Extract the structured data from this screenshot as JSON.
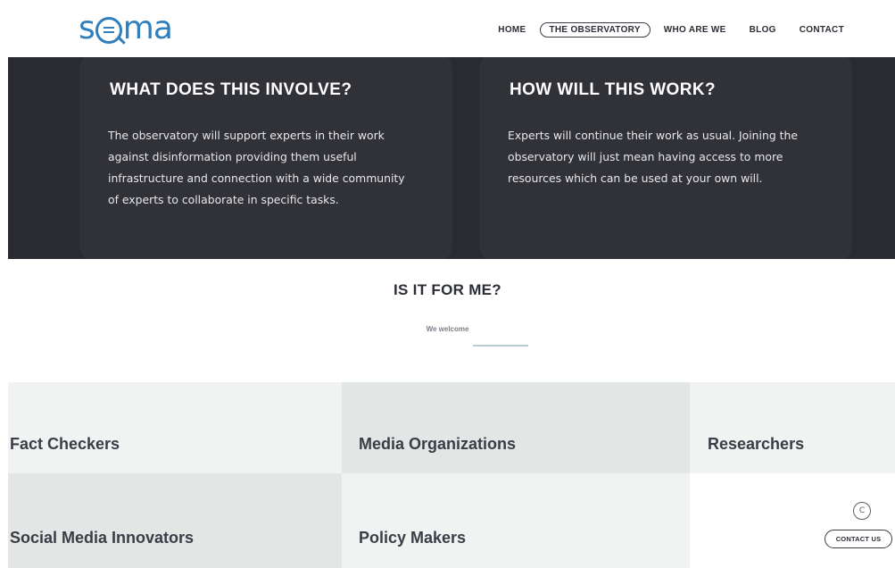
{
  "header": {
    "logo": {
      "before": "s",
      "after": "ma"
    },
    "nav": [
      {
        "label": "HOME",
        "active": false
      },
      {
        "label": "THE OBSERVATORY",
        "active": true
      },
      {
        "label": "WHO ARE WE",
        "active": false
      },
      {
        "label": "BLOG",
        "active": false
      },
      {
        "label": "CONTACT",
        "active": false
      }
    ]
  },
  "cards": [
    {
      "title": "WHAT DOES THIS INVOLVE?",
      "body": "The observatory will support experts in their work against disinformation providing them useful infrastructure and connection with a wide community of experts to collaborate in specific tasks."
    },
    {
      "title": "HOW WILL THIS WORK?",
      "body": "Experts will continue their work as usual. Joining the observatory will just mean having access to more resources which can be used at your own will."
    }
  ],
  "audience": {
    "title": "IS IT FOR ME?",
    "subtitle": "We welcome",
    "groups": [
      "Fact Checkers",
      "Media Organizations",
      "Researchers",
      "Social Media Innovators",
      "Policy Makers"
    ]
  },
  "contact": {
    "icon_glyph": "C",
    "label": "CONTACT US"
  },
  "colors": {
    "brand": "#2f7fbf",
    "dark_band": "#2a2b30",
    "card": "#313238",
    "cell_light": "#f1f3f3",
    "cell_mid": "#e2e7e6"
  }
}
